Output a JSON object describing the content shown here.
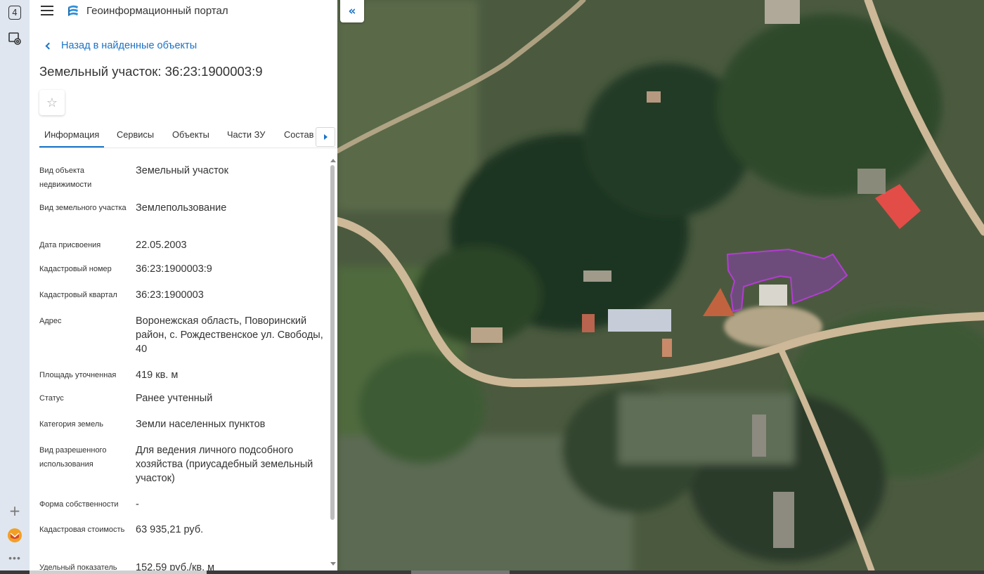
{
  "rail": {
    "badge_count": "4",
    "more_label": "•••"
  },
  "header": {
    "menu_icon": "hamburger-icon",
    "logo_icon": "portal-logo-icon",
    "title": "Геоинформационный портал"
  },
  "back_link": "Назад в найденные объекты",
  "object_title": "Земельный участок: 36:23:1900003:9",
  "favorite_icon": "star-outline-icon",
  "favorite_glyph": "☆",
  "tabs": [
    {
      "label": "Информация",
      "active": true
    },
    {
      "label": "Сервисы",
      "active": false
    },
    {
      "label": "Объекты",
      "active": false
    },
    {
      "label": "Части ЗУ",
      "active": false
    },
    {
      "label": "Состав",
      "active": false
    }
  ],
  "info": [
    {
      "label": "Вид объекта недвижимости",
      "value": "Земельный участок"
    },
    {
      "label": "Вид земельного участка",
      "value": "Землепользование"
    },
    {
      "label": "Дата присвоения",
      "value": "22.05.2003"
    },
    {
      "label": "Кадастровый номер",
      "value": "36:23:1900003:9"
    },
    {
      "label": "Кадастровый квартал",
      "value": "36:23:1900003"
    },
    {
      "label": "Адрес",
      "value": "Воронежская область, Поворинский район, с. Рождественское ул. Свободы, 40"
    },
    {
      "label": "Площадь уточненная",
      "value": "419 кв. м"
    },
    {
      "label": "Статус",
      "value": "Ранее учтенный"
    },
    {
      "label": "Категория земель",
      "value": "Земли населенных пунктов"
    },
    {
      "label": "Вид разрешенного использования",
      "value": "Для ведения личного подсобного хозяйства (приусадебный земельный участок)"
    },
    {
      "label": "Форма собственности",
      "value": "-"
    },
    {
      "label": "Кадастровая стоимость",
      "value": "63 935,21 руб."
    },
    {
      "label": "Удельный показатель",
      "value": "152,59 руб./кв. м"
    }
  ],
  "map": {
    "collapse_glyph": "«",
    "parcel_color": "#b43cd2",
    "accent_color": "#1a73c8"
  }
}
